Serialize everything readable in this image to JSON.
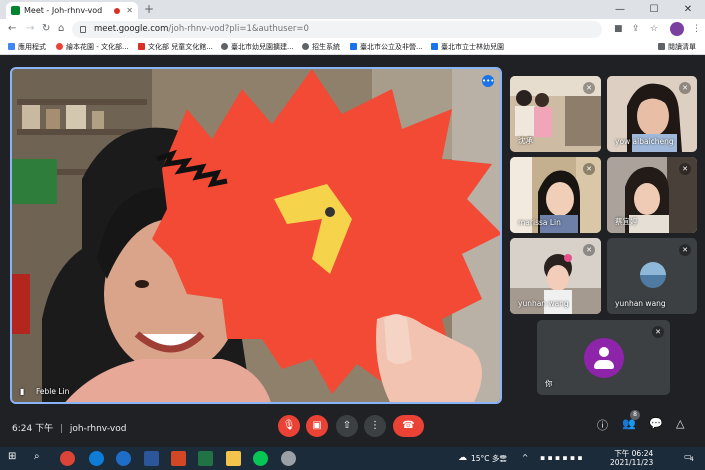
{
  "browser": {
    "tab_title": "Meet - Joh-rhnv-vod",
    "new_tab": "+",
    "url_host": "meet.google.com",
    "url_path": "/joh-rhnv-vod?pli=1&authuser=0",
    "window_controls": [
      "—",
      "☐",
      "✕"
    ]
  },
  "bookmarks": [
    {
      "label": "應用程式",
      "color": "#4285f4"
    },
    {
      "label": "繪本花園 - 文化部...",
      "color": "#ea4335"
    },
    {
      "label": "文化部 兒童文化館...",
      "color": "#d93025"
    },
    {
      "label": "臺北市幼兒園擴建...",
      "color": "#5f6368"
    },
    {
      "label": "招生系統",
      "color": "#5f6368"
    },
    {
      "label": "臺北市公立及非營...",
      "color": "#1a73e8"
    },
    {
      "label": "臺北市立士林幼兒園",
      "color": "#1a73e8"
    },
    {
      "label": "閱讀清單",
      "color": "#5f6368"
    }
  ],
  "main_speaker": {
    "name": "Feble Lin"
  },
  "participants": [
    {
      "name": "沈承"
    },
    {
      "name": "yow aibaicheng"
    },
    {
      "name": "marissa Lin"
    },
    {
      "name": "蔡宜婷"
    },
    {
      "name": "yunhan wang"
    },
    {
      "name": "yunhan wang"
    },
    {
      "name": "你"
    }
  ],
  "controls": {
    "time": "6:24 下午",
    "separator": "|",
    "meeting_code": "joh-rhnv-vod",
    "participants_count": "8"
  },
  "taskbar": {
    "weather": "15°C 多雲",
    "time": "下午 06:24",
    "date": "2021/11/23",
    "notifications": "4"
  },
  "colors": {
    "accent": "#8ab4f8",
    "danger": "#ea4335",
    "bg": "#202124"
  }
}
